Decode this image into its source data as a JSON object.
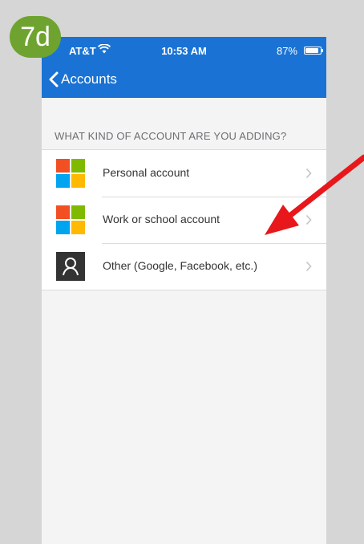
{
  "step_badge": "7d",
  "status_bar": {
    "carrier": "AT&T",
    "time": "10:53 AM",
    "battery": "87%"
  },
  "nav": {
    "back_label": "Accounts"
  },
  "section_header": "WHAT KIND OF ACCOUNT ARE YOU ADDING?",
  "accounts": [
    {
      "label": "Personal account",
      "icon": "microsoft-logo-icon"
    },
    {
      "label": "Work or school account",
      "icon": "microsoft-logo-icon"
    },
    {
      "label": "Other (Google, Facebook, etc.)",
      "icon": "person-icon"
    }
  ],
  "colors": {
    "header_blue": "#1a73d4",
    "badge_green": "#6fa32f",
    "annotation_arrow": "#e8171b",
    "ms_red": "#f25022",
    "ms_green": "#7fba00",
    "ms_blue": "#00a4ef",
    "ms_yellow": "#ffb900"
  }
}
